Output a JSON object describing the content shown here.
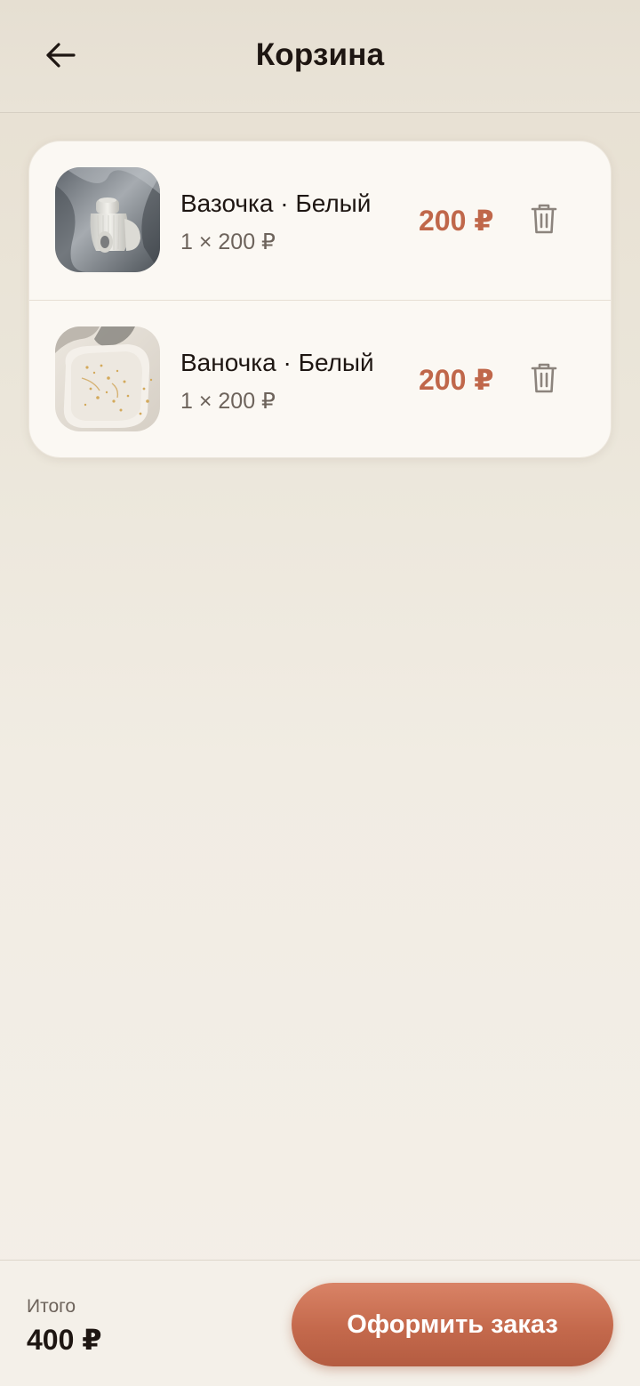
{
  "header": {
    "title": "Корзина",
    "back_icon": "arrow-left-icon"
  },
  "cart": {
    "items": [
      {
        "name": "Вазочка · Белый",
        "quantity_line": "1 × 200 ₽",
        "price": "200 ₽",
        "delete_icon": "trash-icon",
        "image": "white ribbed ceramic vases on grey fabric"
      },
      {
        "name": "Ваночка · Белый",
        "quantity_line": "1 × 200 ₽",
        "price": "200 ₽",
        "delete_icon": "trash-icon",
        "image": "white ceramic tray with gold flecks"
      }
    ]
  },
  "footer": {
    "total_label": "Итого",
    "total_value": "400 ₽",
    "checkout_label": "Оформить заказ"
  },
  "colors": {
    "accent": "#c4694c",
    "price": "#c0674a",
    "text_primary": "#1e1612",
    "text_secondary": "#6d635b",
    "card_background": "#fbf8f3"
  }
}
